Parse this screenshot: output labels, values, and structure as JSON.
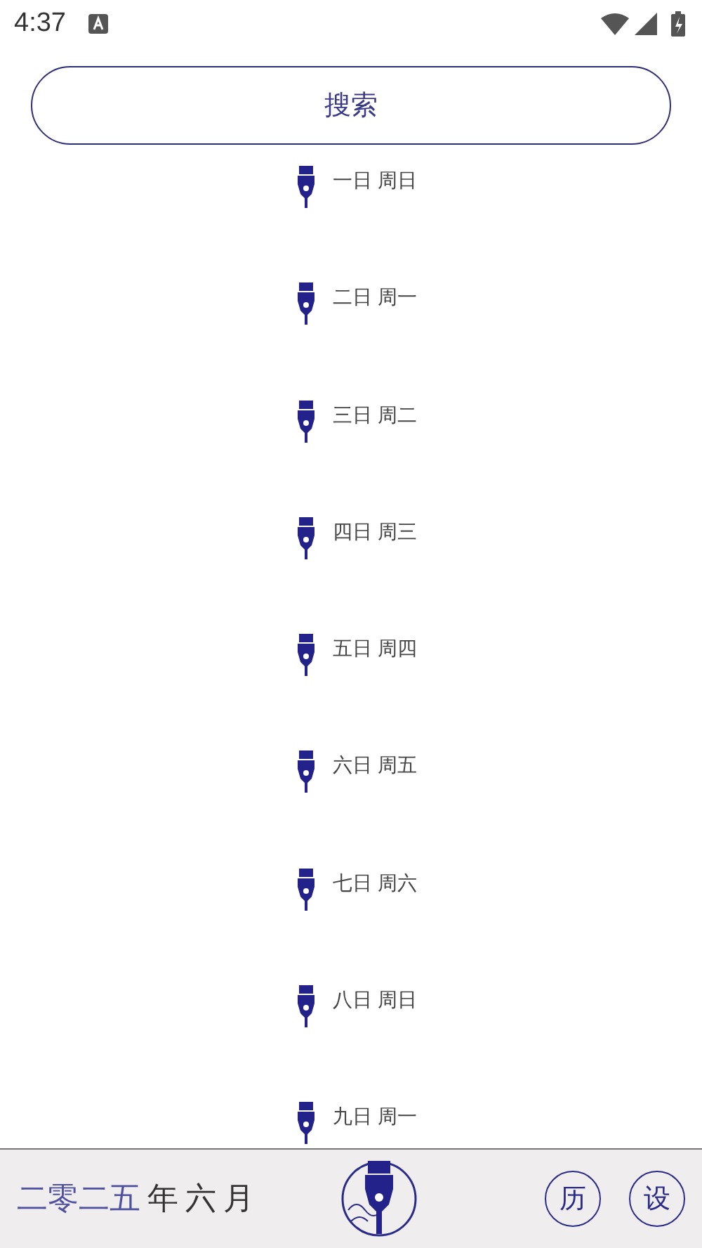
{
  "status_bar": {
    "time": "4:37"
  },
  "search": {
    "label": "搜索"
  },
  "entries": [
    {
      "label": "一日 周日"
    },
    {
      "label": "二日 周一"
    },
    {
      "label": "三日 周二"
    },
    {
      "label": "四日 周三"
    },
    {
      "label": "五日 周四"
    },
    {
      "label": "六日 周五"
    },
    {
      "label": "七日 周六"
    },
    {
      "label": "八日 周日"
    },
    {
      "label": "九日 周一"
    }
  ],
  "bottom_bar": {
    "date_parts": [
      {
        "text": "二零二五",
        "kind": "number"
      },
      {
        "text": "年",
        "kind": "unit"
      },
      {
        "text": "六",
        "kind": "number-dark"
      },
      {
        "text": "月",
        "kind": "unit"
      }
    ],
    "buttons": [
      {
        "label": "历"
      },
      {
        "label": "设"
      }
    ]
  }
}
